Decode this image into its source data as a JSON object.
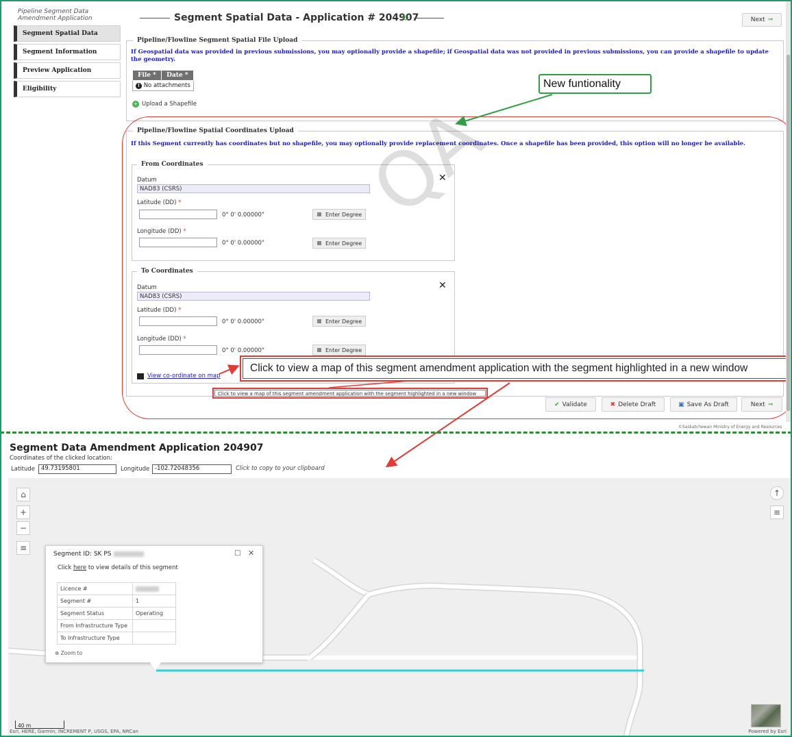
{
  "app": {
    "breadcrumb": "Pipeline Segment Data Amendment Application",
    "title": "Segment Spatial Data - Application # 204907",
    "next_label": "Next"
  },
  "sidebar": {
    "items": [
      {
        "label": "Segment Spatial Data",
        "active": true
      },
      {
        "label": "Segment Information",
        "active": false
      },
      {
        "label": "Preview Application",
        "active": false
      },
      {
        "label": "Eligibility",
        "active": false
      }
    ]
  },
  "file_upload": {
    "legend": "Pipeline/Flowline Segment Spatial File Upload",
    "info": "If Geospatial data was provided in previous submissions, you may optionally provide a shapefile; if Geospatial data was not provided in previous submissions, you can provide a shapefile to update the geometry.",
    "col_file": "File",
    "col_date": "Date",
    "required_mark": "*",
    "no_attachments": "No attachments",
    "upload_label": "Upload a Shapefile"
  },
  "coord_upload": {
    "legend": "Pipeline/Flowline Spatial Coordinates Upload",
    "info": "If this Segment currently has coordinates but no shapefile, you may optionally provide replacement coordinates. Once a shapefile has been provided, this option will no longer be available.",
    "from": {
      "legend": "From Coordinates",
      "datum_label": "Datum",
      "datum_value": "NAD83 (CSRS)",
      "lat_label": "Latitude (DD)",
      "lon_label": "Longitude (DD)",
      "dms": "0° 0' 0.00000\"",
      "enter_degree": "Enter Degree"
    },
    "to": {
      "legend": "To Coordinates",
      "datum_label": "Datum",
      "datum_value": "NAD83 (CSRS)",
      "lat_label": "Latitude (DD)",
      "lon_label": "Longitude (DD)",
      "dms": "0° 0' 0.00000\"",
      "enter_degree": "Enter Degree"
    },
    "view_map_link": "View co-ordinate on map",
    "tooltip": "Click to view a map of this segment amendment application with the segment highlighted in a new window"
  },
  "annotations": {
    "new_functionality": "New funtionality",
    "callout": "Click to view a map of this segment amendment application with the segment highlighted in a new window",
    "watermark": "QA"
  },
  "actions": {
    "validate": "Validate",
    "delete_draft": "Delete Draft",
    "save_draft": "Save As Draft",
    "next": "Next"
  },
  "footer": {
    "copyright": "©Saskatchewan Ministry of Energy and Resources"
  },
  "map_window": {
    "title": "Segment Data Amendment Application 204907",
    "subtitle": "Coordinates of the clicked location:",
    "lat_label": "Latitude",
    "lat_value": "49.73195801",
    "lon_label": "Longitude",
    "lon_value": "-102.72048356",
    "clipboard": "Click to copy to your clipboard",
    "popup": {
      "title": "Segment ID: SK PS",
      "pre_link": "Click ",
      "link": "here",
      "post_link": " to view details of this segment",
      "rows": [
        {
          "key": "Licence #",
          "value": ""
        },
        {
          "key": "Segment #",
          "value": "1"
        },
        {
          "key": "Segment Status",
          "value": "Operating"
        },
        {
          "key": "From Infrastructure Type",
          "value": ""
        },
        {
          "key": "To Infrastructure Type",
          "value": ""
        }
      ],
      "zoom_to": "Zoom to"
    },
    "scale": "40 m",
    "attribution": "Esri, HERE, Garmin, INCREMENT P, USGS, EPA, NRCan",
    "powered_by": "Powered by Esri"
  },
  "colors": {
    "frame": "#1f9a6a",
    "highlight_segment": "#29d3dd",
    "callout_red": "#e53935",
    "callout_green": "#2ea043",
    "info_blue": "#1a1adc"
  }
}
